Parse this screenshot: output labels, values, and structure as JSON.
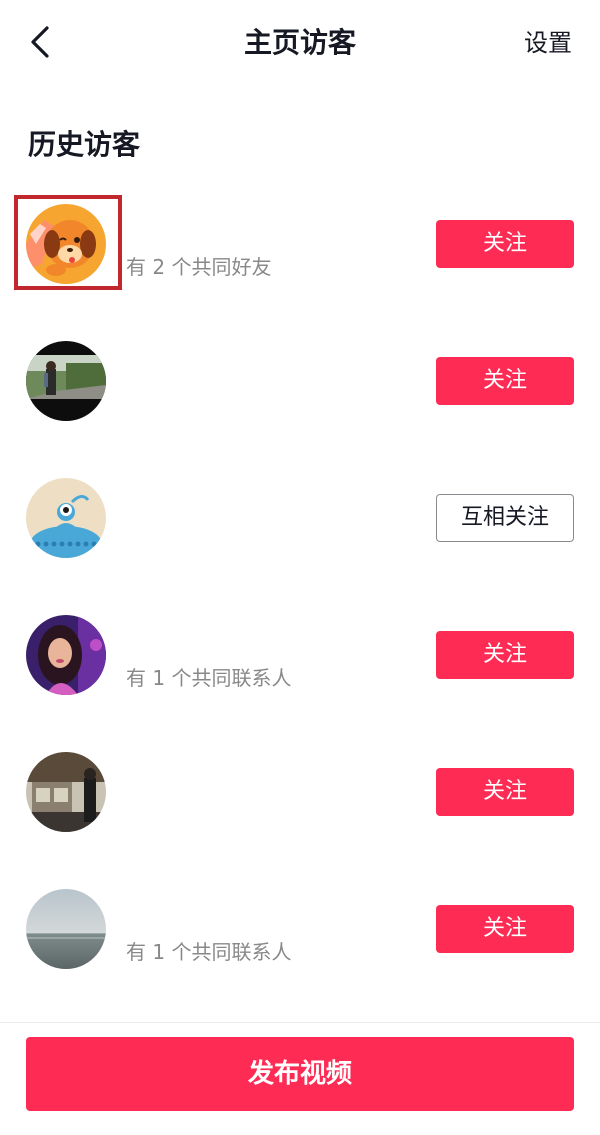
{
  "header": {
    "title": "主页访客",
    "settings_label": "设置",
    "back_icon": "chevron-left-icon"
  },
  "section": {
    "title": "历史访客"
  },
  "visitors": [
    {
      "avatar": "cartoon-dog-avatar",
      "subtitle": "有 2 个共同好友",
      "button_label": "关注",
      "button_style": "follow",
      "highlighted": true
    },
    {
      "avatar": "outdoor-person-avatar",
      "subtitle": "",
      "button_label": "关注",
      "button_style": "follow",
      "highlighted": false
    },
    {
      "avatar": "blue-cartoon-creature-avatar",
      "subtitle": "",
      "button_label": "互相关注",
      "button_style": "mutual",
      "highlighted": false
    },
    {
      "avatar": "woman-portrait-avatar",
      "subtitle": "有 1 个共同联系人",
      "button_label": "关注",
      "button_style": "follow",
      "highlighted": false
    },
    {
      "avatar": "indoor-person-avatar",
      "subtitle": "",
      "button_label": "关注",
      "button_style": "follow",
      "highlighted": false
    },
    {
      "avatar": "sea-landscape-avatar",
      "subtitle": "有 1 个共同联系人",
      "button_label": "关注",
      "button_style": "follow",
      "highlighted": false
    }
  ],
  "footer": {
    "publish_label": "发布视频"
  },
  "colors": {
    "accent": "#fe2c55",
    "highlight_border": "#c1272d",
    "subtitle_text": "#888888"
  }
}
